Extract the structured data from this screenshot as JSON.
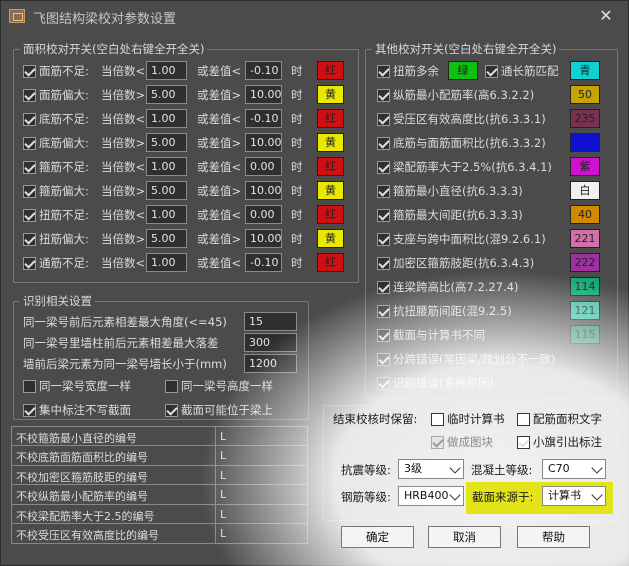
{
  "window": {
    "title": "飞图结构梁校对参数设置",
    "close_glyph": "✕"
  },
  "area_group": {
    "title": "面积校对开关(空白处右键全开全关)",
    "rows": [
      {
        "label": "面筋不足:",
        "cmp": "当倍数<",
        "ratio": "1.00",
        "cmp2": "或差值<",
        "diff": "-0.10",
        "unit": "时",
        "color": "红",
        "hex": "#d01010",
        "checked": true
      },
      {
        "label": "面筋偏大:",
        "cmp": "当倍数>",
        "ratio": "5.00",
        "cmp2": "或差值>",
        "diff": "10.00",
        "unit": "时",
        "color": "黄",
        "hex": "#e8e800",
        "checked": true
      },
      {
        "label": "底筋不足:",
        "cmp": "当倍数<",
        "ratio": "1.00",
        "cmp2": "或差值<",
        "diff": "-0.10",
        "unit": "时",
        "color": "红",
        "hex": "#d01010",
        "checked": true
      },
      {
        "label": "底筋偏大:",
        "cmp": "当倍数>",
        "ratio": "5.00",
        "cmp2": "或差值>",
        "diff": "10.00",
        "unit": "时",
        "color": "黄",
        "hex": "#e8e800",
        "checked": true
      },
      {
        "label": "箍筋不足:",
        "cmp": "当倍数<",
        "ratio": "1.00",
        "cmp2": "或差值<",
        "diff": "0.00",
        "unit": "时",
        "color": "红",
        "hex": "#d01010",
        "checked": true
      },
      {
        "label": "箍筋偏大:",
        "cmp": "当倍数>",
        "ratio": "5.00",
        "cmp2": "或差值>",
        "diff": "10.00",
        "unit": "时",
        "color": "黄",
        "hex": "#e8e800",
        "checked": true
      },
      {
        "label": "扭筋不足:",
        "cmp": "当倍数<",
        "ratio": "1.00",
        "cmp2": "或差值<",
        "diff": "0.00",
        "unit": "时",
        "color": "红",
        "hex": "#d01010",
        "checked": true
      },
      {
        "label": "扭筋偏大:",
        "cmp": "当倍数>",
        "ratio": "5.00",
        "cmp2": "或差值>",
        "diff": "10.00",
        "unit": "时",
        "color": "黄",
        "hex": "#e8e800",
        "checked": true
      },
      {
        "label": "通筋不足:",
        "cmp": "当倍数<",
        "ratio": "1.00",
        "cmp2": "或差值<",
        "diff": "-0.10",
        "unit": "时",
        "color": "红",
        "hex": "#d01010",
        "checked": true
      }
    ]
  },
  "other_group": {
    "title": "其他校对开关(空白处右键全开全关)",
    "first_row": {
      "label_a": "扭筋多余",
      "color_a": "绿",
      "hex_a": "#10c010",
      "label_b": "通长筋匹配",
      "color_b": "青",
      "hex_b": "#10d0d0"
    },
    "rows": [
      {
        "label": "纵筋最小配筋率(高6.3.2.2)",
        "color": "50",
        "hex": "#c8a400",
        "checked": true
      },
      {
        "label": "受压区有效高度比(抗6.3.3.1)",
        "color": "235",
        "hex": "#7a3050",
        "checked": true
      },
      {
        "label": "底筋与面筋面积比(抗6.3.3.2)",
        "color": "",
        "hex": "#1010d0",
        "checked": true
      },
      {
        "label": "梁配筋率大于2.5%(抗6.3.4.1)",
        "color": "紫",
        "hex": "#d010d0",
        "checked": true
      },
      {
        "label": "箍筋最小直径(抗6.3.3.3)",
        "color": "白",
        "hex": "#f0f0f0",
        "checked": true
      },
      {
        "label": "箍筋最大间距(抗6.3.3.3)",
        "color": "40",
        "hex": "#d08a00",
        "checked": true
      },
      {
        "label": "支座与跨中面积比(混9.2.6.1)",
        "color": "221",
        "hex": "#d070a8",
        "checked": true
      },
      {
        "label": "加密区箍筋肢距(抗6.3.4.3)",
        "color": "222",
        "hex": "#a030a0",
        "checked": true
      },
      {
        "label": "连梁跨高比(高7.2.27.4)",
        "color": "114",
        "hex": "#10a870",
        "checked": true
      },
      {
        "label": "抗扭腰筋间距(混9.2.5)",
        "color": "121",
        "hex": "#40c0a8",
        "checked": true
      },
      {
        "label": "截面与计算书不同",
        "color": "115",
        "hex": "#2a8a70",
        "checked": true
      },
      {
        "label": "分跨错误(常因梁/跨划分不一致)",
        "color": null,
        "hex": null,
        "checked": true
      },
      {
        "label": "识别错误(多种原因)",
        "color": null,
        "hex": null,
        "checked": true
      }
    ]
  },
  "recog_group": {
    "title": "识别相关设置",
    "fields": [
      {
        "label": "同一梁号前后元素相差最大角度(<=45)",
        "value": "15"
      },
      {
        "label": "同一梁号里墙柱前后元素相差最大落差",
        "value": "300"
      },
      {
        "label": "墙前后梁元素为同一梁号墙长小于(mm)",
        "value": "1200"
      }
    ],
    "checks": [
      {
        "label": "同一梁号宽度一样",
        "checked": false
      },
      {
        "label": "同一梁号高度一样",
        "checked": false
      },
      {
        "label": "集中标注不写截面",
        "checked": true
      },
      {
        "label": "截面可能位于梁上",
        "checked": true
      }
    ]
  },
  "table": {
    "rows": [
      {
        "key": "不校箍筋最小直径的编号",
        "value": "L"
      },
      {
        "key": "不校底筋面筋面积比的编号",
        "value": "L"
      },
      {
        "key": "不校加密区箍筋肢距的编号",
        "value": "L"
      },
      {
        "key": "不校纵筋最小配筋率的编号",
        "value": "L"
      },
      {
        "key": "不校梁配筋率大于2.5的编号",
        "value": "L"
      },
      {
        "key": "不校受压区有效高度比的编号",
        "value": "L"
      }
    ]
  },
  "end_panel": {
    "keep_label": "结束校核时保留:",
    "temp_calc": {
      "label": "临时计算书",
      "checked": false
    },
    "rebar_text": {
      "label": "配筋面积文字",
      "checked": false
    },
    "make_block": {
      "label": "做成图块",
      "checked": true,
      "disabled": true
    },
    "small_flag": {
      "label": "小旗引出标注",
      "checked": true
    },
    "seismic_label": "抗震等级:",
    "seismic_value": "3级",
    "concrete_label": "混凝土等级:",
    "concrete_value": "C70",
    "steel_label": "钢筋等级:",
    "steel_value": "HRB400",
    "section_label": "截面来源于:",
    "section_value": "计算书",
    "highlight_color": "#e3e31a"
  },
  "buttons": {
    "ok": "确定",
    "cancel": "取消",
    "help": "帮助"
  }
}
